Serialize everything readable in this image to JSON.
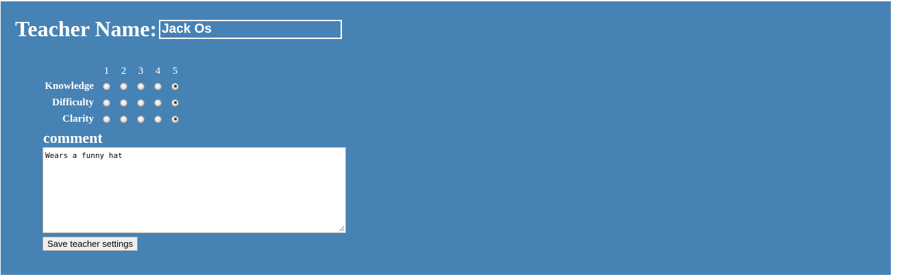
{
  "teacher": {
    "label": "Teacher Name:",
    "value": "Jack Os"
  },
  "scale": [
    "1",
    "2",
    "3",
    "4",
    "5"
  ],
  "ratings": [
    {
      "label": "Knowledge",
      "selected": 5
    },
    {
      "label": "Difficulty",
      "selected": 5
    },
    {
      "label": "Clarity",
      "selected": 5
    }
  ],
  "comment": {
    "label": "comment",
    "value": "Wears a funny hat"
  },
  "save_button": {
    "label": "Save teacher settings"
  },
  "colors": {
    "background": "#4682b4",
    "text": "#ffffff"
  }
}
